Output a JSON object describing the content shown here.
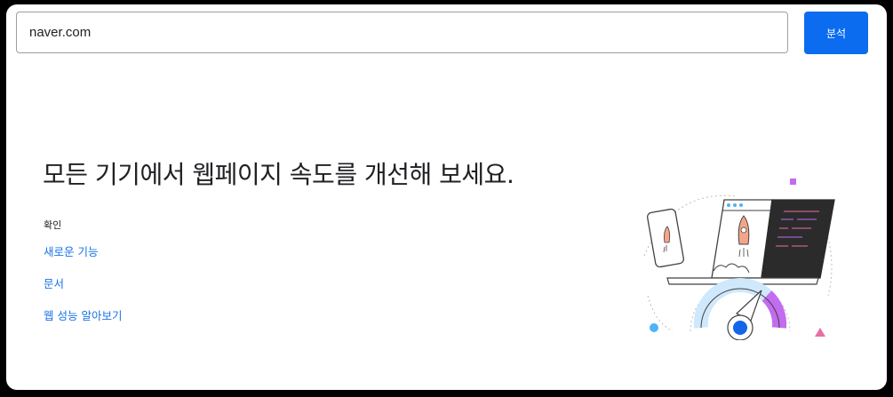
{
  "search": {
    "value": "naver.com",
    "button_label": "분석"
  },
  "hero": {
    "headline": "모든 기기에서 웹페이지 속도를 개선해 보세요."
  },
  "links_section": {
    "label": "확인",
    "items": [
      {
        "label": "새로운 기능"
      },
      {
        "label": "문서"
      },
      {
        "label": "웹 성능 알아보기"
      }
    ]
  },
  "colors": {
    "accent": "#0b6cf0",
    "link": "#1a73e8",
    "gauge_purple": "#c26cf0",
    "gauge_blue": "#1565e8",
    "code_panel": "#2b2b2b"
  }
}
